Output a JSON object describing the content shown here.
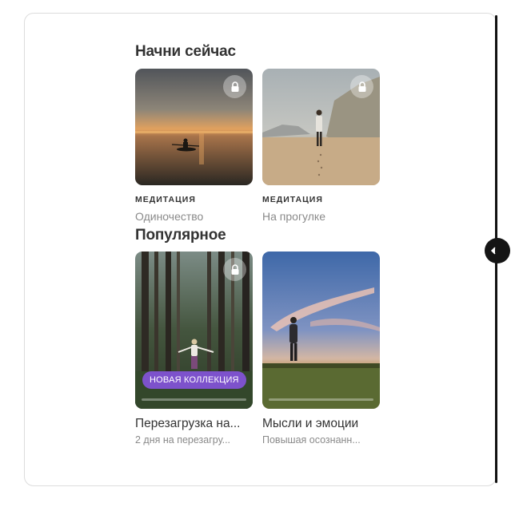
{
  "sections": {
    "start_now": {
      "title": "Начни сейчас",
      "cards": [
        {
          "category": "МЕДИТАЦИЯ",
          "title": "Одиночество",
          "locked": true,
          "image": "kayak-sunset"
        },
        {
          "category": "МЕДИТАЦИЯ",
          "title": "На прогулке",
          "locked": true,
          "image": "beach-walk"
        }
      ]
    },
    "popular": {
      "title": "Популярное",
      "cards": [
        {
          "title": "Перезагрузка на...",
          "subtitle": "2 дня на перезагру...",
          "badge": "НОВАЯ КОЛЛЕКЦИЯ",
          "locked": true,
          "image": "forest-woman"
        },
        {
          "title": "Мысли и эмоции",
          "subtitle": "Повышая осознанн...",
          "locked": false,
          "image": "field-sky"
        }
      ]
    }
  },
  "icons": {
    "lock": "lock-icon",
    "handle": "chevron-left-icon"
  },
  "colors": {
    "badge": "#7d52cc",
    "heading": "#333333",
    "muted": "#8a8a8a"
  }
}
